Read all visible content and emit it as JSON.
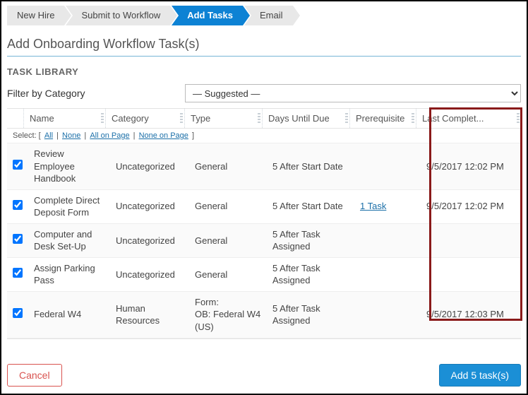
{
  "breadcrumbs": [
    {
      "label": "New Hire",
      "active": false
    },
    {
      "label": "Submit to Workflow",
      "active": false
    },
    {
      "label": "Add Tasks",
      "active": true
    },
    {
      "label": "Email",
      "active": false
    }
  ],
  "page_title": "Add Onboarding Workflow Task(s)",
  "section_label": "TASK LIBRARY",
  "filter": {
    "label": "Filter by Category",
    "selected": "— Suggested —"
  },
  "columns": {
    "name": "Name",
    "category": "Category",
    "type": "Type",
    "days": "Days Until Due",
    "prereq": "Prerequisite",
    "last": "Last Complet..."
  },
  "select_bar": {
    "prefix": "Select: [",
    "all": "All",
    "none": "None",
    "all_page": "All on Page",
    "none_page": "None on Page",
    "suffix": "]"
  },
  "rows": [
    {
      "checked": true,
      "name": "Review Employee Handbook",
      "category": "Uncategorized",
      "type": "General",
      "days": "5 After Start Date",
      "prereq": "",
      "prereq_link": "",
      "last": "9/5/2017 12:02 PM"
    },
    {
      "checked": true,
      "name": "Complete Direct Deposit Form",
      "category": "Uncategorized",
      "type": "General",
      "days": "5 After Start Date",
      "prereq": "",
      "prereq_link": "1 Task",
      "last": "9/5/2017 12:02 PM"
    },
    {
      "checked": true,
      "name": "Computer and Desk Set-Up",
      "category": "Uncategorized",
      "type": "General",
      "days": "5 After Task Assigned",
      "prereq": "",
      "prereq_link": "",
      "last": ""
    },
    {
      "checked": true,
      "name": "Assign Parking Pass",
      "category": "Uncategorized",
      "type": "General",
      "days": "5 After Task Assigned",
      "prereq": "",
      "prereq_link": "",
      "last": ""
    },
    {
      "checked": true,
      "name": "Federal W4",
      "category": "Human Resources",
      "type": "Form:\nOB: Federal W4 (US)",
      "days": "5 After Task Assigned",
      "prereq": "",
      "prereq_link": "",
      "last": "9/5/2017 12:03 PM"
    }
  ],
  "buttons": {
    "cancel": "Cancel",
    "add": "Add 5 task(s)"
  }
}
